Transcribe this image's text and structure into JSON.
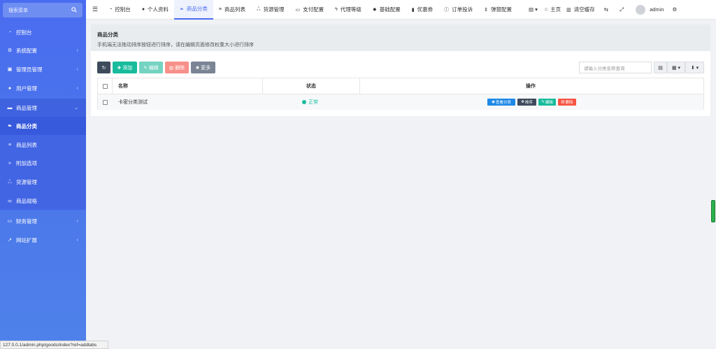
{
  "sidebar": {
    "search_placeholder": "搜索菜单",
    "items": [
      {
        "label": "控制台",
        "icon": "dashboard-icon"
      },
      {
        "label": "系统配置",
        "icon": "gears-icon"
      },
      {
        "label": "管理员管理",
        "icon": "user-group-icon"
      },
      {
        "label": "用户管理",
        "icon": "user-icon"
      },
      {
        "label": "商品管理",
        "icon": "cart-icon"
      },
      {
        "label": "商品分类",
        "icon": "leaf-icon"
      },
      {
        "label": "商品列表",
        "icon": "list-icon"
      },
      {
        "label": "附加选项",
        "icon": "chevron-right-icon"
      },
      {
        "label": "货源管理",
        "icon": "sitemap-icon"
      },
      {
        "label": "商品规格",
        "icon": "sliders-icon"
      },
      {
        "label": "财务管理",
        "icon": "wallet-icon"
      },
      {
        "label": "网站扩展",
        "icon": "external-link-icon"
      }
    ]
  },
  "topnav": {
    "items": [
      {
        "label": "控制台",
        "icon": "dashboard-icon"
      },
      {
        "label": "个人资料",
        "icon": "user-icon"
      },
      {
        "label": "商品分类",
        "icon": "leaf-icon"
      },
      {
        "label": "商品列表",
        "icon": "list-icon"
      },
      {
        "label": "货源管理",
        "icon": "sitemap-icon"
      },
      {
        "label": "支付配置",
        "icon": "credit-card-icon"
      },
      {
        "label": "代理等级",
        "icon": "bolt-icon"
      },
      {
        "label": "基础配置",
        "icon": "gear-icon"
      },
      {
        "label": "优惠券",
        "icon": "bookmark-icon"
      },
      {
        "label": "订单投诉",
        "icon": "info-icon"
      },
      {
        "label": "弹窗配置",
        "icon": "sort-icon"
      }
    ],
    "home_label": "主页",
    "clear_cache_label": "清空缓存",
    "username": "admin"
  },
  "panel": {
    "title": "商品分类",
    "tip": "手机端无法拖动排序按钮进行排序，请在编辑页面修改权重大小进行排序"
  },
  "toolbar": {
    "add_label": "添加",
    "edit_label": "编辑",
    "delete_label": "删除",
    "more_label": "更多",
    "search_placeholder": "请输入分类名称查询"
  },
  "table": {
    "headers": {
      "name": "名称",
      "status": "状态",
      "ops": "操作"
    },
    "rows": [
      {
        "name": "卡密分类测试",
        "status": "正常"
      }
    ],
    "ops": {
      "view": "查看分类",
      "sort": "排序",
      "edit": "编辑",
      "delete": "删除"
    }
  },
  "statusbar": {
    "url": "127.0.0.1/admin.php/goods/index?ref=addtabs"
  },
  "colors": {
    "sidebar": "#4a6cf0",
    "primary": "#4a6cf0",
    "success": "#18bc9c",
    "danger": "#f75444",
    "dark": "#3d4b5c",
    "info": "#1e88e5",
    "gray": "#7b8494"
  }
}
